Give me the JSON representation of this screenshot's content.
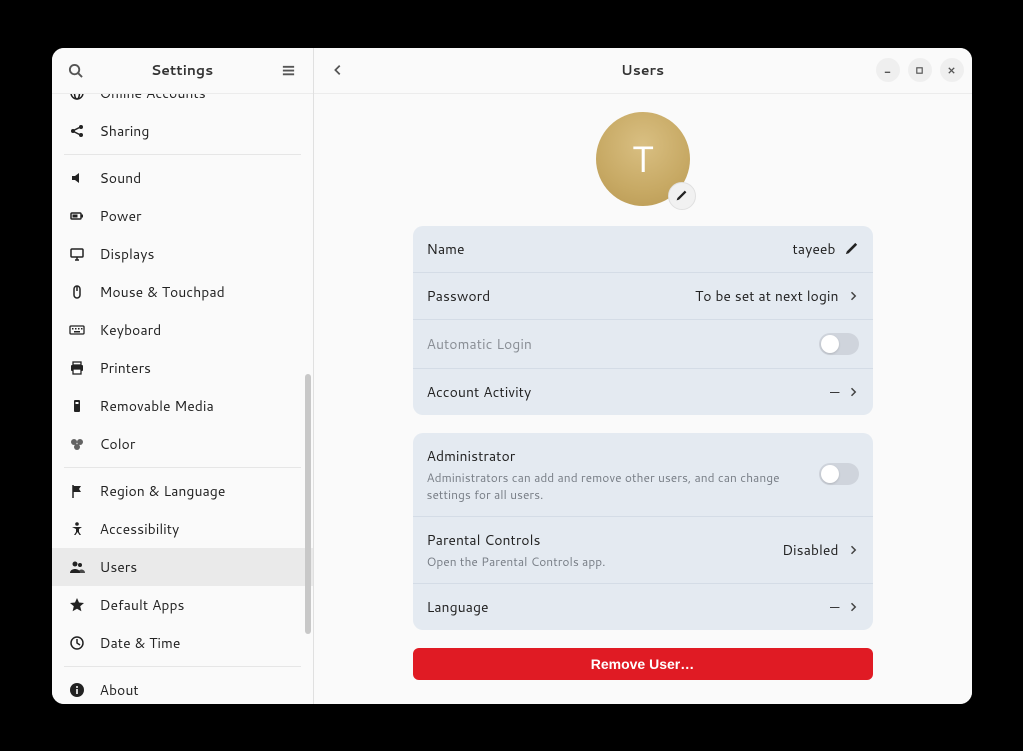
{
  "sidebar": {
    "title": "Settings",
    "items": [
      {
        "label": "Online Accounts",
        "icon": "online-accounts"
      },
      {
        "label": "Sharing",
        "icon": "share"
      }
    ],
    "items2": [
      {
        "label": "Sound",
        "icon": "sound"
      },
      {
        "label": "Power",
        "icon": "power"
      },
      {
        "label": "Displays",
        "icon": "displays"
      },
      {
        "label": "Mouse & Touchpad",
        "icon": "mouse"
      },
      {
        "label": "Keyboard",
        "icon": "keyboard"
      },
      {
        "label": "Printers",
        "icon": "printers"
      },
      {
        "label": "Removable Media",
        "icon": "removable"
      },
      {
        "label": "Color",
        "icon": "color"
      }
    ],
    "items3": [
      {
        "label": "Region & Language",
        "icon": "flag"
      },
      {
        "label": "Accessibility",
        "icon": "accessibility"
      },
      {
        "label": "Users",
        "icon": "users",
        "selected": true
      },
      {
        "label": "Default Apps",
        "icon": "star"
      },
      {
        "label": "Date & Time",
        "icon": "clock"
      }
    ],
    "items4": [
      {
        "label": "About",
        "icon": "info"
      }
    ]
  },
  "main": {
    "title": "Users",
    "avatar_initial": "T",
    "rows1": {
      "name_label": "Name",
      "name_value": "tayeeb",
      "password_label": "Password",
      "password_value": "To be set at next login",
      "autologin_label": "Automatic Login",
      "activity_label": "Account Activity",
      "activity_value": "—"
    },
    "rows2": {
      "admin_label": "Administrator",
      "admin_sublabel": "Administrators can add and remove other users, and can change settings for all users.",
      "parental_label": "Parental Controls",
      "parental_sublabel": "Open the Parental Controls app.",
      "parental_value": "Disabled",
      "language_label": "Language",
      "language_value": "—"
    },
    "remove_label": "Remove User…"
  }
}
